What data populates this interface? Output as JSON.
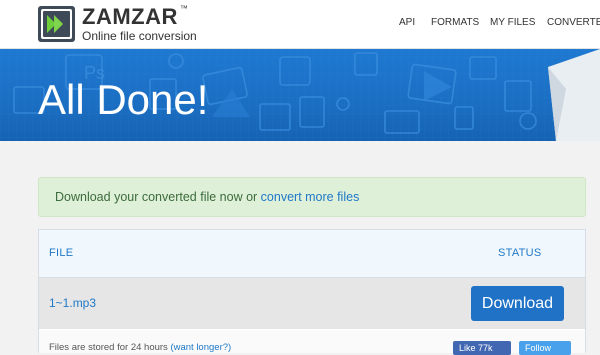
{
  "header": {
    "brand": "ZAMZAR",
    "trademark": "™",
    "tagline": "Online file conversion",
    "nav": [
      {
        "label": "API"
      },
      {
        "label": "FORMATS"
      },
      {
        "label": "MY FILES"
      },
      {
        "label": "CONVERTER"
      }
    ]
  },
  "banner": {
    "title": "All Done!"
  },
  "alert": {
    "text": "Download your converted file now or ",
    "link": "convert more files"
  },
  "table": {
    "columns": {
      "file": "FILE",
      "status": "STATUS"
    },
    "rows": [
      {
        "filename": "1~1.mp3",
        "action": "Download"
      }
    ],
    "footer": {
      "text": "Files are stored for 24 hours ",
      "link": "(want longer?)"
    }
  },
  "social": {
    "like": "Like 77k",
    "follow": "Follow"
  },
  "colors": {
    "accent": "#1f72c5",
    "banner": "#1b6ec2",
    "alert_bg": "#dff0d8",
    "link": "#1f78c8"
  }
}
